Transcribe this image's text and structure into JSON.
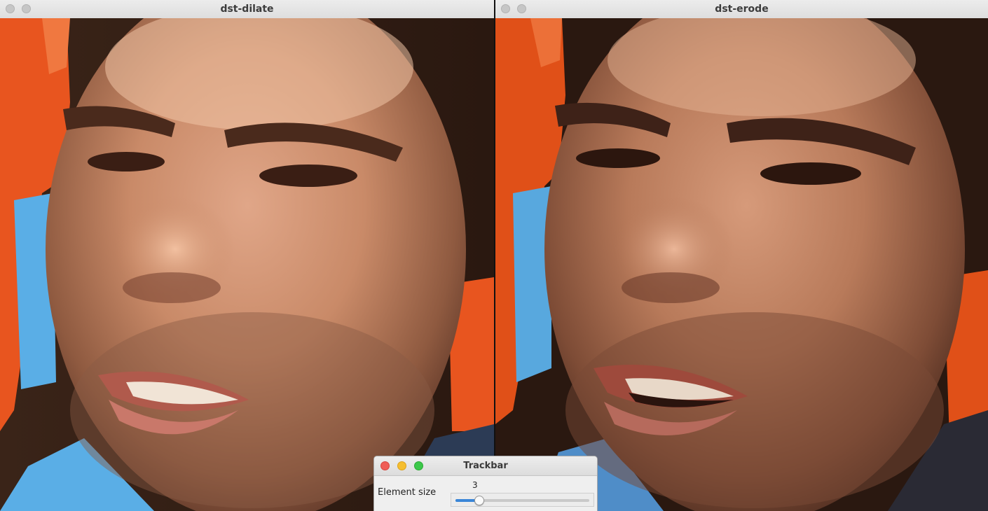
{
  "windows": {
    "dilate": {
      "title": "dst-dilate"
    },
    "erode": {
      "title": "dst-erode"
    }
  },
  "trackbar": {
    "title": "Trackbar",
    "label": "Element size",
    "value": "3",
    "level": 0.18
  },
  "colors": {
    "accent": "#3a86d8",
    "shirt_orange": "#e8551f",
    "shirt_blue": "#5aaee6",
    "skin": "#c98a68"
  }
}
